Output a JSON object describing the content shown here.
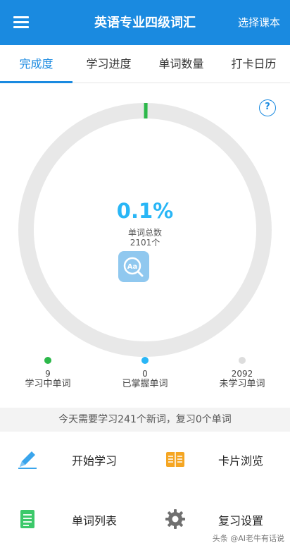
{
  "appbar": {
    "title": "英语专业四级词汇",
    "select_book": "选择课本"
  },
  "tabs": [
    {
      "label": "完成度",
      "active": true
    },
    {
      "label": "学习进度",
      "active": false
    },
    {
      "label": "单词数量",
      "active": false
    },
    {
      "label": "打卡日历",
      "active": false
    }
  ],
  "help": {
    "symbol": "?"
  },
  "progress": {
    "percent_text": "0.1%",
    "percent_value": 0.1,
    "total_label": "单词总数",
    "total_value": "2101个"
  },
  "legend": [
    {
      "count": "9",
      "label": "学习中单词",
      "color": "#2cb84a"
    },
    {
      "count": "0",
      "label": "已掌握单词",
      "color": "#29b6f6"
    },
    {
      "count": "2092",
      "label": "未学习单词",
      "color": "#dddddd"
    }
  ],
  "notice": "今天需要学习241个新词，复习0个单词",
  "actions": {
    "start_study": "开始学习",
    "card_browse": "卡片浏览",
    "word_list": "单词列表",
    "review_settings": "复习设置"
  },
  "watermark": "头条 @AI老牛有话说",
  "colors": {
    "primary": "#1a8ae0",
    "accent": "#29b6f6",
    "ring_track": "#e8e8e8",
    "learning": "#2cb84a",
    "mastered": "#29b6f6"
  }
}
